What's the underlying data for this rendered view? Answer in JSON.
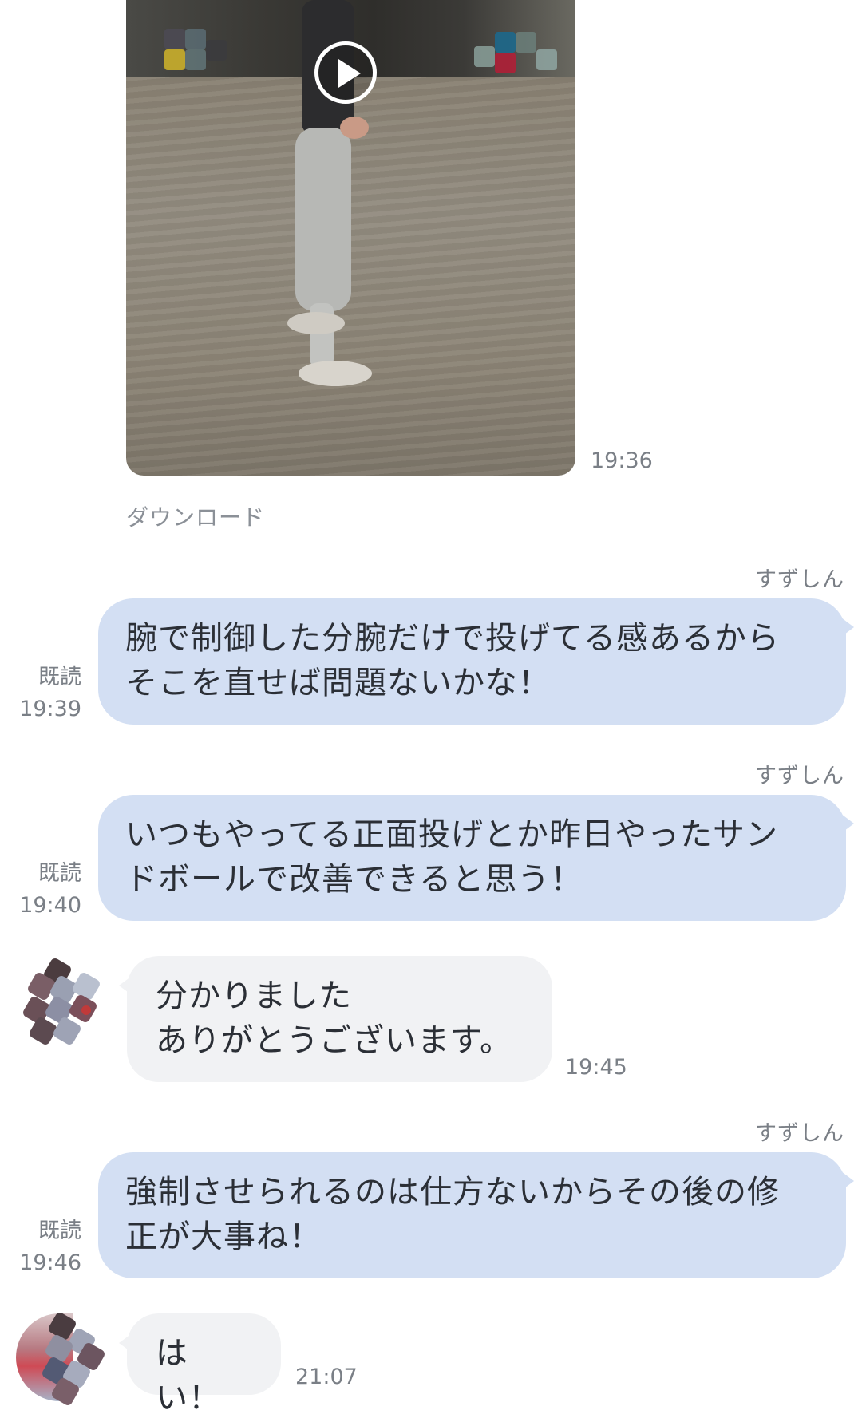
{
  "video": {
    "timestamp": "19:36",
    "download_label": "ダウンロード"
  },
  "messages": [
    {
      "sender": "すずしん",
      "lines": [
        "腕で制御した分腕だけで投げてる感あるから",
        "そこを直せば問題ないかな！"
      ],
      "read": "既読",
      "time": "19:39"
    },
    {
      "sender": "すずしん",
      "lines": [
        "いつもやってる正面投げとか昨日やったサン",
        "ドボールで改善できると思う！"
      ],
      "read": "既読",
      "time": "19:40"
    },
    {
      "lines": [
        "分かりました",
        "ありがとうございます。"
      ],
      "time": "19:45"
    },
    {
      "sender": "すずしん",
      "lines": [
        "強制させられるのは仕方ないからその後の修",
        "正が大事ね！"
      ],
      "read": "既読",
      "time": "19:46"
    },
    {
      "lines": [
        "はい！"
      ],
      "time": "21:07"
    }
  ],
  "colors": {
    "outgoing_bubble": "#d3dff3",
    "incoming_bubble": "#f1f2f4",
    "meta_text": "#7a7f86"
  }
}
